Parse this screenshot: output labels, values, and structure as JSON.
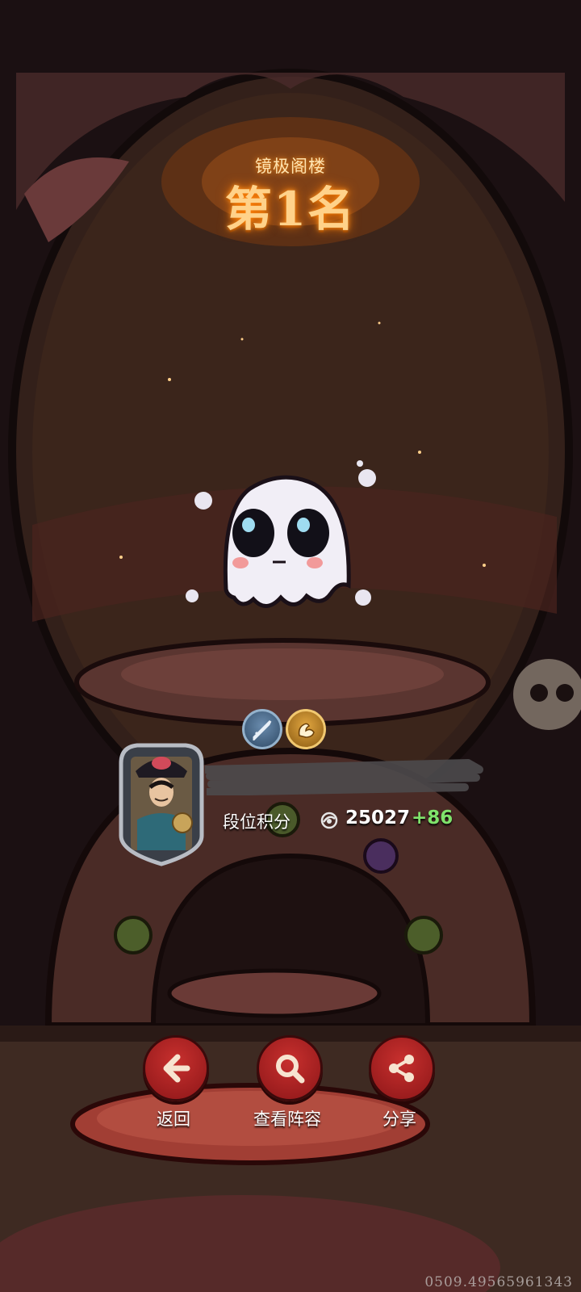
{
  "header": {
    "subtitle": "镜极阁楼",
    "rank": "第1名"
  },
  "player": {
    "score_label": "段位积分",
    "score_value": "25027",
    "score_delta": "+86",
    "badges": [
      "sword-icon",
      "flexed-arm-icon"
    ]
  },
  "actions": [
    {
      "label": "返回",
      "icon": "arrow-left-icon"
    },
    {
      "label": "查看阵容",
      "icon": "magnifier-icon"
    },
    {
      "label": "分享",
      "icon": "share-icon"
    }
  ],
  "watermark": "0509.49565961343",
  "colors": {
    "title_glow": "#ff8c1a",
    "score_delta": "#7fe36b",
    "button_red": "#c8302e"
  }
}
